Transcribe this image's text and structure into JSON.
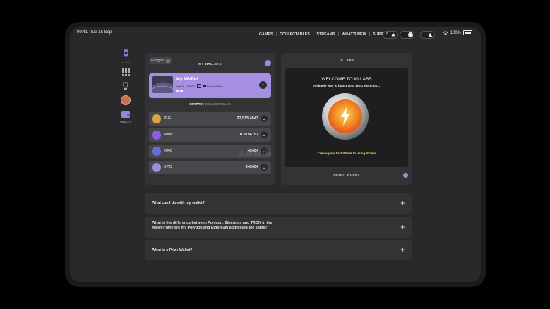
{
  "status": {
    "time": "09:41",
    "date": "Tue 15 Sep",
    "battery": "100%"
  },
  "nav": {
    "games": "GAMES",
    "collectables": "COLLECTABLES",
    "streams": "STREAMS",
    "whats_new": "WHAT'S NEW",
    "support": "SUPPORT",
    "notif_count": "5"
  },
  "sidebar": {
    "wallet_label": "WALLET"
  },
  "wallets": {
    "network": "Polygon",
    "title": "MY WALLETS",
    "my_wallet": {
      "name": "My Wallet",
      "address": "0xaF4... 97d07",
      "tag": "Prize Wallet"
    },
    "tabs": {
      "crypto": "CRYPTO",
      "sep": "|",
      "collectables": "COLLECTABLES"
    },
    "coins": [
      {
        "name": "IGG",
        "amount": "27,915.4543",
        "color": "#d9a441"
      },
      {
        "name": "Matic",
        "amount": "0.9756757",
        "color": "#8d5de8"
      },
      {
        "name": "ORB",
        "amount": "43434",
        "color": "#6b6bd8"
      },
      {
        "name": "XPC",
        "amount": "343434",
        "color": "#a28bd8"
      }
    ]
  },
  "overlay_text": "Upload file",
  "iglabs": {
    "title": "IG LABS",
    "welcome": "WELCOME TO IG LABS",
    "subtitle": "A simple way to boost your $IGG earnings...",
    "cta": "Create your first Wallet to using IGlabs",
    "how": "HOW IT WORKS"
  },
  "faq": [
    {
      "q1": "What can I do with my wallet?",
      "q2": ""
    },
    {
      "q1": "What is the difference between Polygon, Ethereum and TRON in the",
      "q2": "wallet? Why are my Polygon and Ethereum addresses the same?"
    },
    {
      "q1": "What is a Prize Wallet?",
      "q2": ""
    }
  ]
}
